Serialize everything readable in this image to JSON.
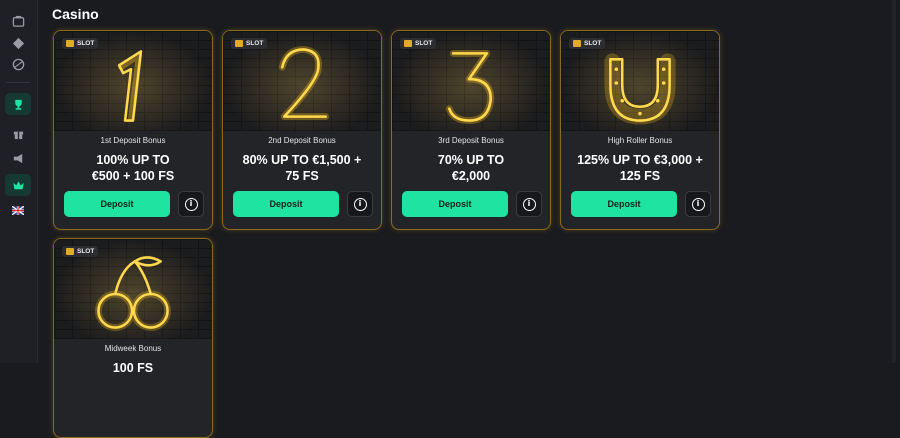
{
  "page": {
    "title": "Casino"
  },
  "sidebar": {
    "icons": [
      "casino-icon",
      "diamond-icon",
      "sports-ball-icon",
      "trophy-icon",
      "gift-icon",
      "megaphone-icon",
      "crown-icon",
      "uk-flag-icon"
    ],
    "active": [
      "trophy-icon",
      "crown-icon"
    ]
  },
  "cards": [
    {
      "badge": "SLOT",
      "art": "neon-1",
      "subtitle": "1st Deposit Bonus",
      "title_line1": "100% UP TO",
      "title_line2": "€500 + 100 FS",
      "button": "Deposit"
    },
    {
      "badge": "SLOT",
      "art": "neon-2",
      "subtitle": "2nd Deposit Bonus",
      "title_line1": "80% UP TO €1,500 +",
      "title_line2": "75 FS",
      "button": "Deposit"
    },
    {
      "badge": "SLOT",
      "art": "neon-3",
      "subtitle": "3rd Deposit Bonus",
      "title_line1": "70% UP TO",
      "title_line2": "€2,000",
      "button": "Deposit"
    },
    {
      "badge": "SLOT",
      "art": "neon-horseshoe",
      "subtitle": "High Roller Bonus",
      "title_line1": "125% UP TO €3,000 +",
      "title_line2": "125 FS",
      "button": "Deposit"
    },
    {
      "badge": "SLOT",
      "art": "neon-cherries",
      "subtitle": "Midweek Bonus",
      "title_line1": "100 FS",
      "title_line2": "",
      "button": "Deposit"
    }
  ],
  "colors": {
    "accent": "#1fe3a0",
    "neon": "#ffc21a",
    "card_border": "#8a6a1c",
    "background": "#1a1b1f"
  }
}
